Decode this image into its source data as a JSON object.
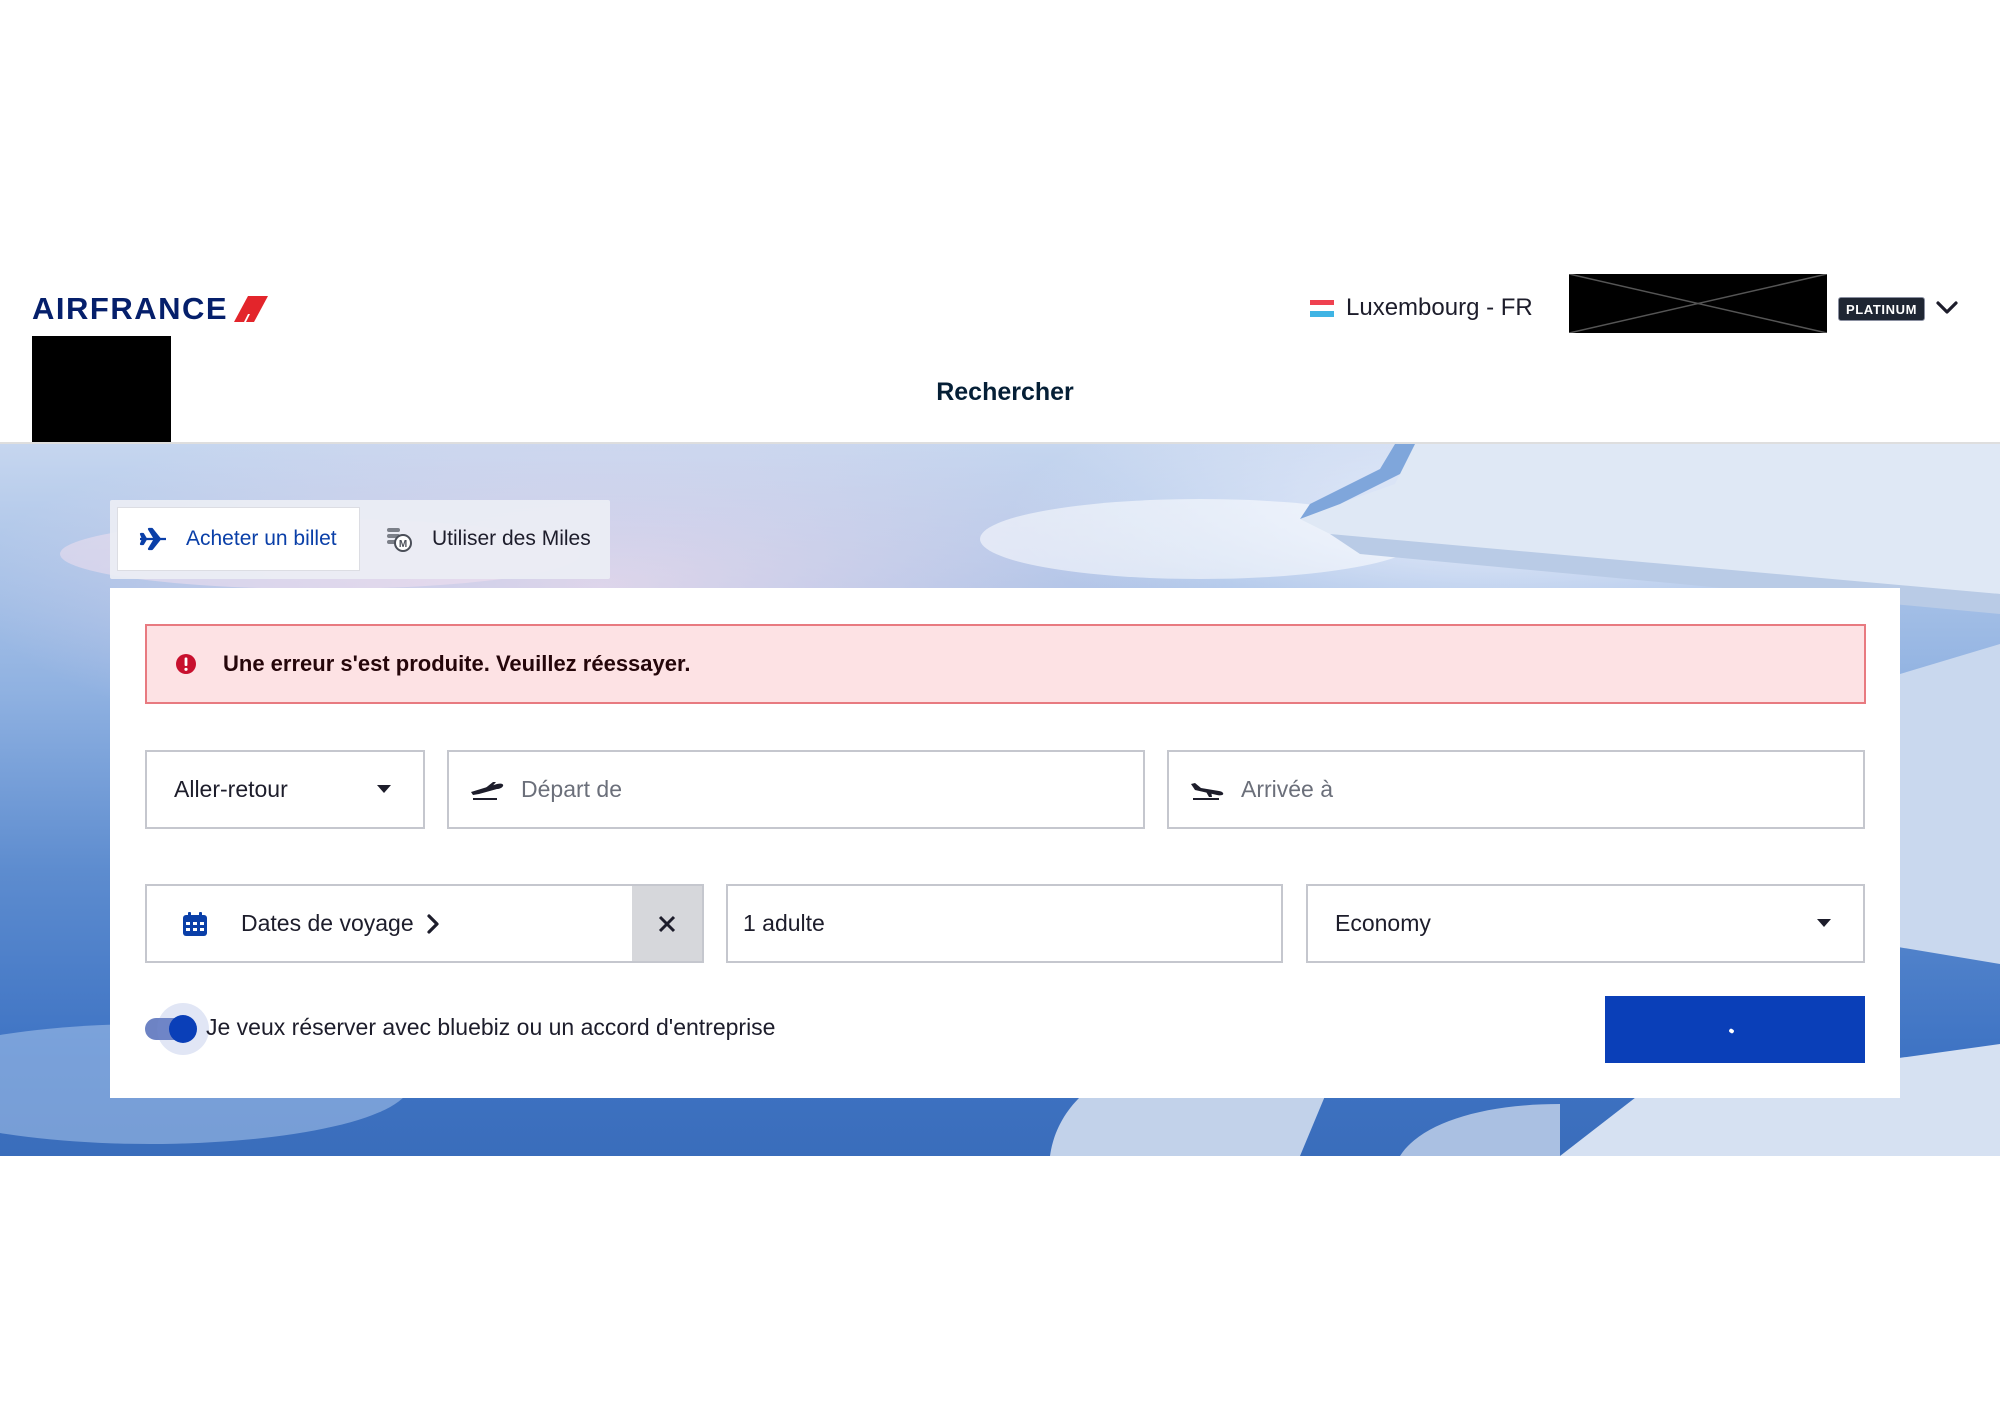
{
  "brand": {
    "logo_text": "AIRFRANCE",
    "logo_color": "#051f6b",
    "flag_color": "#e3252b"
  },
  "header": {
    "locale_label": "Luxembourg - FR",
    "locale_flag_colors": [
      "#ef4150",
      "#ffffff",
      "#3fb4e4"
    ],
    "tier_badge": "PLATINUM",
    "account_menu_icon": "chevron-down-icon",
    "title": "Rechercher"
  },
  "tabs": [
    {
      "label": "Acheter un billet",
      "icon": "plane-icon",
      "active": true
    },
    {
      "label": "Utiliser des Miles",
      "icon": "miles-coins-icon",
      "active": false
    }
  ],
  "alert": {
    "message": "Une erreur s'est produite. Veuillez réessayer.",
    "icon": "error-circle-icon",
    "background": "#fde2e4",
    "border": "#e87a80"
  },
  "form": {
    "trip_type": {
      "value": "Aller-retour",
      "icon": "caret-down-icon"
    },
    "origin": {
      "placeholder": "Départ de",
      "icon": "takeoff-icon"
    },
    "destination": {
      "placeholder": "Arrivée à",
      "icon": "landing-icon"
    },
    "dates": {
      "label": "Dates de voyage",
      "icon": "calendar-icon",
      "clear_icon": "close-icon"
    },
    "passengers": {
      "value": "1 adulte"
    },
    "cabin": {
      "value": "Economy",
      "icon": "caret-down-icon"
    },
    "corporate_toggle": {
      "label": "Je veux réserver avec bluebiz ou un accord d'entreprise",
      "on": true
    },
    "submit": {
      "state": "loading",
      "color": "#0a3fb8"
    }
  },
  "colors": {
    "accent": "#0a3fb8",
    "tab_active_text": "#0a3fa8"
  }
}
